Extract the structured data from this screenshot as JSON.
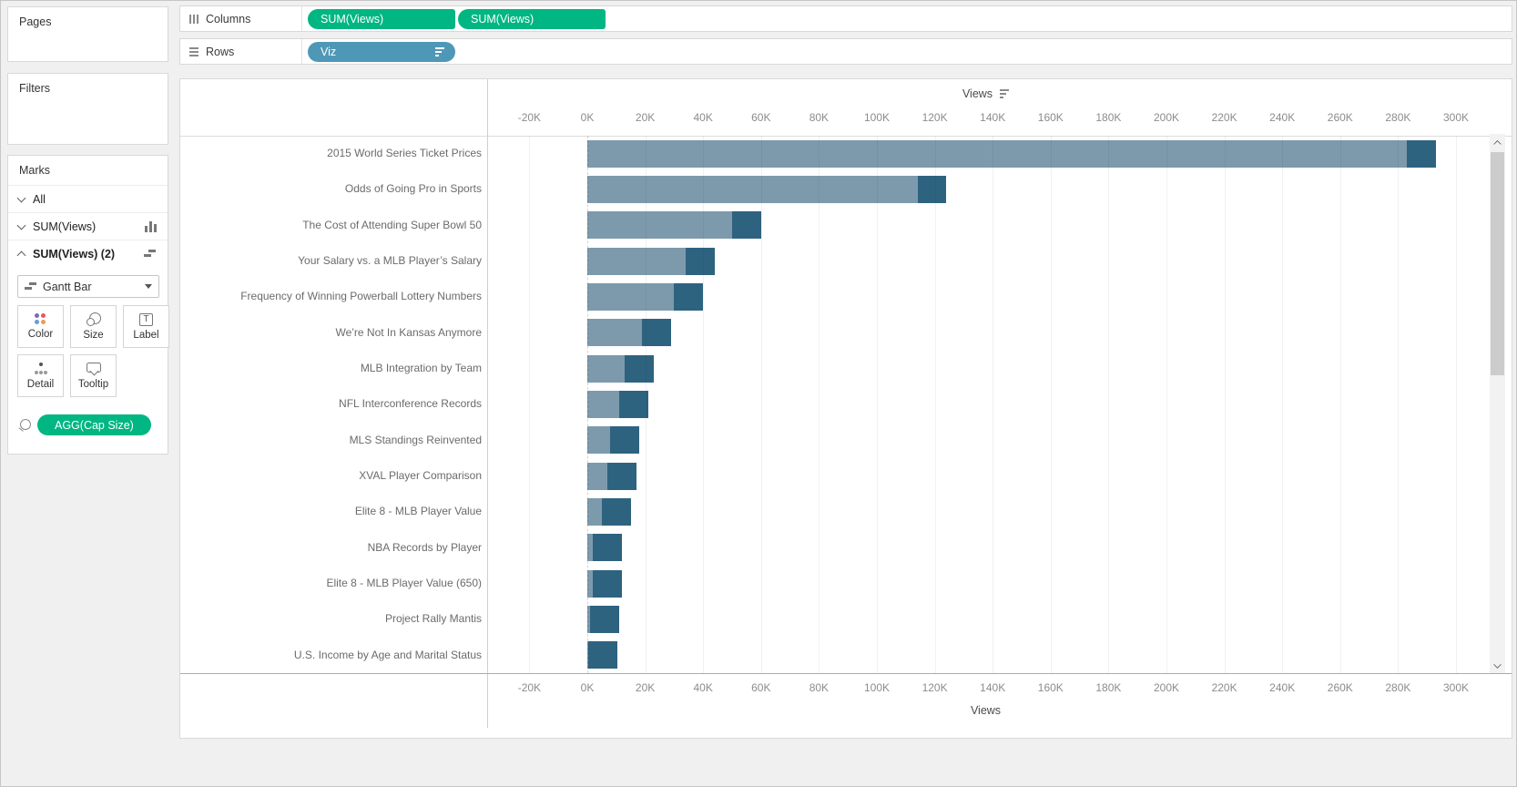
{
  "colors": {
    "pill_measure": "#00b682",
    "pill_dimension": "#4f97b7"
  },
  "sidebar": {
    "pages": {
      "title": "Pages"
    },
    "filters": {
      "title": "Filters"
    },
    "marks": {
      "title": "Marks",
      "sections": [
        {
          "label": "All",
          "chevron": "down",
          "icon": null,
          "bold": false
        },
        {
          "label": "SUM(Views)",
          "chevron": "down",
          "icon": "barchart",
          "bold": false
        },
        {
          "label": "SUM(Views) (2)",
          "chevron": "up",
          "icon": "gantt",
          "bold": true
        }
      ],
      "mark_type": "Gantt Bar",
      "buttons": [
        {
          "label": "Color",
          "icon": "color"
        },
        {
          "label": "Size",
          "icon": "size"
        },
        {
          "label": "Label",
          "icon": "label"
        },
        {
          "label": "Detail",
          "icon": "detail"
        },
        {
          "label": "Tooltip",
          "icon": "tooltip"
        }
      ],
      "encoding_pill": "AGG(Cap Size)"
    }
  },
  "shelves": {
    "columns": {
      "label": "Columns",
      "pills": [
        "SUM(Views)",
        "SUM(Views)"
      ]
    },
    "rows": {
      "label": "Rows",
      "pills": [
        "Viz"
      ]
    }
  },
  "chart_data": {
    "type": "bar",
    "orientation": "horizontal",
    "axis_title_top": "Views",
    "axis_title_bottom": "Views",
    "sort": "descending",
    "tick_labels": [
      "-20K",
      "0K",
      "20K",
      "40K",
      "60K",
      "80K",
      "100K",
      "120K",
      "140K",
      "160K",
      "180K",
      "200K",
      "220K",
      "240K",
      "260K",
      "280K",
      "300K"
    ],
    "tick_values_k": [
      -20,
      0,
      20,
      40,
      60,
      80,
      100,
      120,
      140,
      160,
      180,
      200,
      220,
      240,
      260,
      280,
      300
    ],
    "axis_range_k": [
      -35,
      310
    ],
    "grid": true,
    "categories": [
      "2015 World Series Ticket Prices",
      "Odds of Going Pro in Sports",
      "The Cost of Attending Super Bowl 50",
      "Your Salary vs. a MLB Player’s Salary",
      "Frequency of Winning Powerball Lottery Numbers",
      "We’re Not In Kansas Anymore",
      "MLB Integration by Team",
      "NFL Interconference Records",
      "MLS Standings Reinvented",
      "XVAL Player Comparison",
      "Elite 8 - MLB Player Value",
      "NBA Records by Player",
      "Elite 8 - MLB Player Value (650)",
      "Project Rally Mantis",
      "U.S. Income by Age and Marital Status"
    ],
    "values_k": [
      283,
      114,
      50,
      34,
      30,
      19,
      13,
      11,
      8,
      7,
      5,
      2,
      2,
      1,
      0.3
    ],
    "cap_size_k": 10,
    "colors": {
      "bar": "#7d9aac",
      "cap": "#2e6380"
    }
  }
}
